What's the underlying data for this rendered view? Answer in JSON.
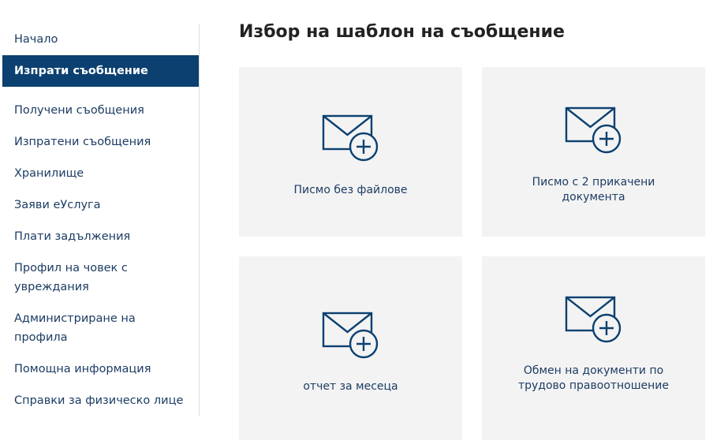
{
  "sidebar": {
    "items": [
      {
        "label": "Начало"
      },
      {
        "label": "Изпрати съобщение"
      },
      {
        "label": "Получени съобщения"
      },
      {
        "label": "Изпратени съобщения"
      },
      {
        "label": "Хранилище"
      },
      {
        "label": "Заяви еУслуга"
      },
      {
        "label": "Плати задължения"
      },
      {
        "label": "Профил на човек с увреждания"
      },
      {
        "label": "Администриране на профила"
      },
      {
        "label": "Помощна информация"
      },
      {
        "label": "Справки за физическо лице"
      }
    ],
    "active_index": 1
  },
  "main": {
    "title": "Избор на шаблон на съобщение",
    "templates": [
      {
        "label": "Писмо без файлове",
        "icon": "envelope-plus-icon"
      },
      {
        "label": "Писмо с 2 прикачени документа",
        "icon": "envelope-plus-icon"
      },
      {
        "label": "отчет за месеца",
        "icon": "envelope-plus-icon"
      },
      {
        "label": "Обмен на документи по трудово правоотношение",
        "icon": "envelope-plus-icon"
      }
    ]
  },
  "colors": {
    "accent": "#0b4070",
    "text": "#1d3c64",
    "card_bg": "#f3f3f3"
  }
}
